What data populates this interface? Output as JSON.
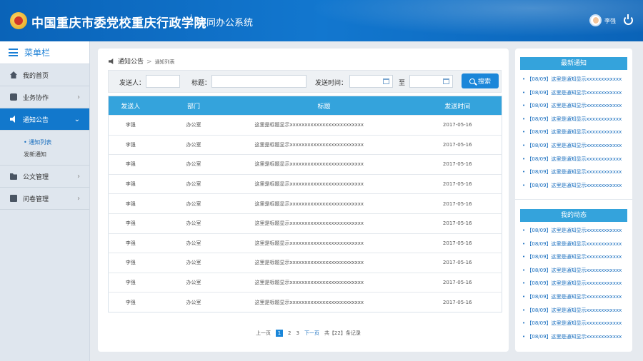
{
  "header": {
    "app_title": "中国重庆市委党校重庆行政学院",
    "system_title": "协同办公系统",
    "username": "李强"
  },
  "sidebar": {
    "menu_title": "菜单栏",
    "items": [
      {
        "label": "我的首页",
        "icon": "home-icon"
      },
      {
        "label": "业务协作",
        "icon": "briefcase-icon"
      },
      {
        "label": "通知公告",
        "icon": "speaker-icon",
        "active": true
      },
      {
        "label": "公文管理",
        "icon": "folder-icon"
      },
      {
        "label": "问卷管理",
        "icon": "book-icon"
      }
    ],
    "subitems": [
      {
        "label": "通知列表",
        "active": true
      },
      {
        "label": "发新通知"
      }
    ]
  },
  "breadcrumb": {
    "root": "通知公告",
    "current": "通知列表"
  },
  "filter": {
    "sender_label": "发送人：",
    "title_label": "标题：",
    "time_label": "发送时间：",
    "to_label": "至",
    "search_label": "搜索",
    "sender_value": "",
    "title_value": "",
    "start_value": "",
    "end_value": ""
  },
  "table": {
    "columns": [
      "发送人",
      "部门",
      "标题",
      "发送时间"
    ],
    "rows": [
      {
        "sender": "李强",
        "dept": "办公室",
        "title": "这里是标题显示xxxxxxxxxxxxxxxxxxxxxxxxx",
        "time": "2017-05-16"
      },
      {
        "sender": "李强",
        "dept": "办公室",
        "title": "这里是标题显示xxxxxxxxxxxxxxxxxxxxxxxxx",
        "time": "2017-05-16"
      },
      {
        "sender": "李强",
        "dept": "办公室",
        "title": "这里是标题显示xxxxxxxxxxxxxxxxxxxxxxxxx",
        "time": "2017-05-16"
      },
      {
        "sender": "李强",
        "dept": "办公室",
        "title": "这里是标题显示xxxxxxxxxxxxxxxxxxxxxxxxx",
        "time": "2017-05-16"
      },
      {
        "sender": "李强",
        "dept": "办公室",
        "title": "这里是标题显示xxxxxxxxxxxxxxxxxxxxxxxxx",
        "time": "2017-05-16"
      },
      {
        "sender": "李强",
        "dept": "办公室",
        "title": "这里是标题显示xxxxxxxxxxxxxxxxxxxxxxxxx",
        "time": "2017-05-16"
      },
      {
        "sender": "李强",
        "dept": "办公室",
        "title": "这里是标题显示xxxxxxxxxxxxxxxxxxxxxxxxx",
        "time": "2017-05-16"
      },
      {
        "sender": "李强",
        "dept": "办公室",
        "title": "这里是标题显示xxxxxxxxxxxxxxxxxxxxxxxxx",
        "time": "2017-05-16"
      },
      {
        "sender": "李强",
        "dept": "办公室",
        "title": "这里是标题显示xxxxxxxxxxxxxxxxxxxxxxxxx",
        "time": "2017-05-16"
      },
      {
        "sender": "李强",
        "dept": "办公室",
        "title": "这里是标题显示xxxxxxxxxxxxxxxxxxxxxxxxx",
        "time": "2017-05-16"
      }
    ]
  },
  "pager": {
    "prev": "上一页",
    "pages": [
      "1",
      "2",
      "3"
    ],
    "current_page": "1",
    "next": "下一页",
    "total": "共【22】条记录"
  },
  "right": {
    "latest_title": "最新通知",
    "latest": [
      "【08/09】这里是通知显示xxxxxxxxxxxx",
      "【08/09】这里是通知显示xxxxxxxxxxxx",
      "【08/09】这里是通知显示xxxxxxxxxxxx",
      "【08/09】这里是通知显示xxxxxxxxxxxx",
      "【08/09】这里是通知显示xxxxxxxxxxxx",
      "【08/09】这里是通知显示xxxxxxxxxxxx",
      "【08/09】这里是通知显示xxxxxxxxxxxx",
      "【08/09】这里是通知显示xxxxxxxxxxxx",
      "【08/09】这里是通知显示xxxxxxxxxxxx"
    ],
    "activity_title": "我的动态",
    "activity": [
      "【08/09】这里是通知显示xxxxxxxxxxxx",
      "【08/09】这里是通知显示xxxxxxxxxxxx",
      "【08/09】这里是通知显示xxxxxxxxxxxx",
      "【08/09】这里是通知显示xxxxxxxxxxxx",
      "【08/09】这里是通知显示xxxxxxxxxxxx",
      "【08/09】这里是通知显示xxxxxxxxxxxx",
      "【08/09】这里是通知显示xxxxxxxxxxxx",
      "【08/09】这里是通知显示xxxxxxxxxxxx",
      "【08/09】这里是通知显示xxxxxxxxxxxx"
    ]
  },
  "colors": {
    "header_blue": "#1277cf",
    "accent_blue": "#34a3dc",
    "active_nav": "#1278cc"
  }
}
